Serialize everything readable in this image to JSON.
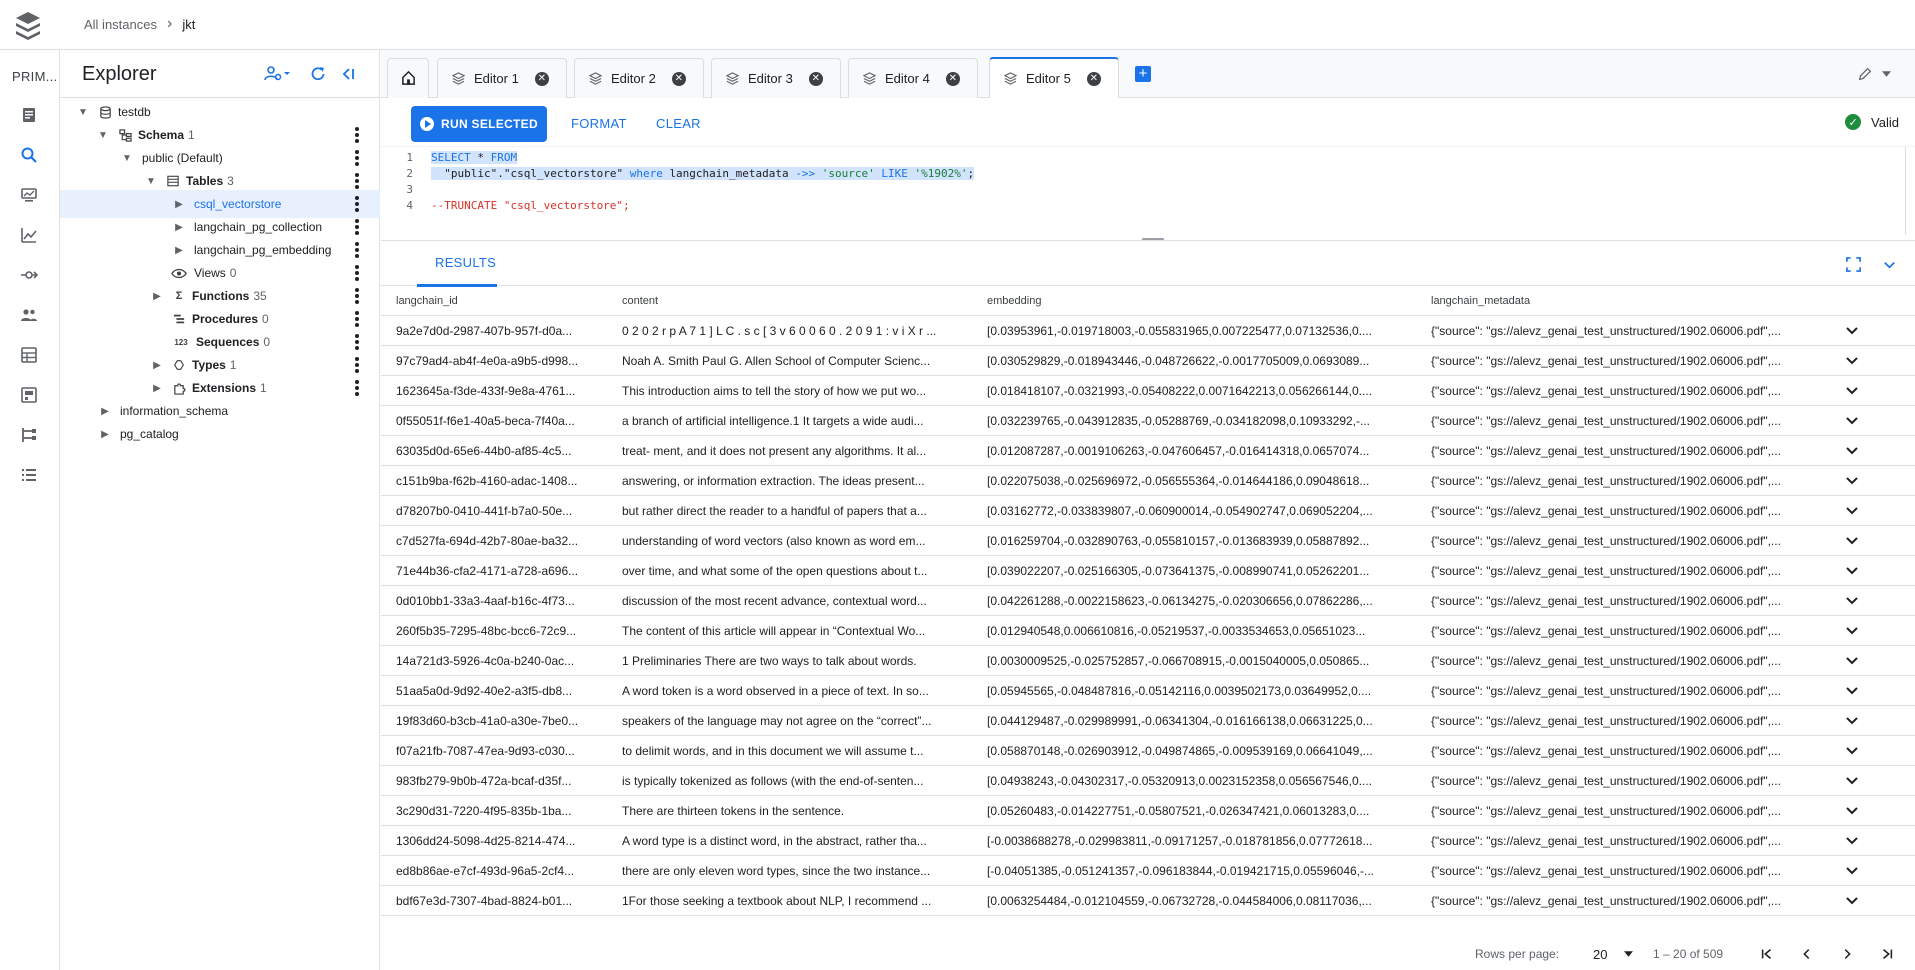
{
  "breadcrumb": {
    "root": "All instances",
    "current": "jkt"
  },
  "rail": {
    "title": "PRIM..."
  },
  "explorer": {
    "title": "Explorer",
    "tree": [
      {
        "name": "tree-node-testdb",
        "label": "testdb",
        "count": ""
      },
      {
        "name": "tree-node-schema",
        "label": "Schema",
        "count": "1"
      },
      {
        "name": "tree-node-public",
        "label": "public (Default)",
        "count": ""
      },
      {
        "name": "tree-node-tables",
        "label": "Tables",
        "count": "3"
      },
      {
        "name": "tree-node-csql-vectorstore",
        "label": "csql_vectorstore",
        "count": ""
      },
      {
        "name": "tree-node-langchain-pg-collection",
        "label": "langchain_pg_collection",
        "count": ""
      },
      {
        "name": "tree-node-langchain-pg-embedding",
        "label": "langchain_pg_embedding",
        "count": ""
      },
      {
        "name": "tree-node-views",
        "label": "Views",
        "count": "0"
      },
      {
        "name": "tree-node-functions",
        "label": "Functions",
        "count": "35"
      },
      {
        "name": "tree-node-procedures",
        "label": "Procedures",
        "count": "0"
      },
      {
        "name": "tree-node-sequences",
        "label": "Sequences",
        "count": "0"
      },
      {
        "name": "tree-node-types",
        "label": "Types",
        "count": "1"
      },
      {
        "name": "tree-node-extensions",
        "label": "Extensions",
        "count": "1"
      },
      {
        "name": "tree-node-information-schema",
        "label": "information_schema",
        "count": ""
      },
      {
        "name": "tree-node-pg-catalog",
        "label": "pg_catalog",
        "count": ""
      }
    ]
  },
  "tabs": [
    {
      "label": "Editor 1"
    },
    {
      "label": "Editor 2"
    },
    {
      "label": "Editor 3"
    },
    {
      "label": "Editor 4"
    },
    {
      "label": "Editor 5"
    }
  ],
  "toolbar": {
    "run_label": "RUN SELECTED",
    "format_label": "FORMAT",
    "clear_label": "CLEAR",
    "status_label": "Valid"
  },
  "editor": {
    "lines": [
      {
        "num": "1"
      },
      {
        "num": "2"
      },
      {
        "num": "3"
      },
      {
        "num": "4"
      }
    ],
    "l1_select": "SELECT",
    "l1_star": " * ",
    "l1_from": "FROM",
    "l2_indent": "  ",
    "l2_schema": "\"public\"",
    "l2_dot": ".",
    "l2_table": "\"csql_vectorstore\"",
    "l2_where": " where ",
    "l2_col": "langchain_metadata",
    "l2_op": " ->> ",
    "l2_key": "'source'",
    "l2_like": " LIKE ",
    "l2_pattern": "'%1902%'",
    "l2_semi": ";",
    "l4_comment": "--TRUNCATE \"csql_vectorstore\";"
  },
  "results": {
    "tab_label": "RESULTS",
    "columns": [
      "langchain_id",
      "content",
      "embedding",
      "langchain_metadata"
    ],
    "rows": [
      [
        "9a2e7d0d-2987-407b-957f-d0a...",
        "0 2 0 2 r p A 7 1 ] L C . s c [ 3 v 6 0 0 6 0 . 2 0 9 1 : v i X r ...",
        "[0.03953961,-0.019718003,-0.055831965,0.007225477,0.07132536,0....",
        "{\"source\": \"gs://alevz_genai_test_unstructured/1902.06006.pdf\",..."
      ],
      [
        "97c79ad4-ab4f-4e0a-a9b5-d998...",
        "Noah A. Smith Paul G. Allen School of Computer Scienc...",
        "[0.030529829,-0.018943446,-0.048726622,-0.0017705009,0.0693089...",
        "{\"source\": \"gs://alevz_genai_test_unstructured/1902.06006.pdf\",..."
      ],
      [
        "1623645a-f3de-433f-9e8a-4761...",
        "This introduction aims to tell the story of how we put wo...",
        "[0.018418107,-0.0321993,-0.05408222,0.0071642213,0.056266144,0....",
        "{\"source\": \"gs://alevz_genai_test_unstructured/1902.06006.pdf\",..."
      ],
      [
        "0f55051f-f6e1-40a5-beca-7f40a...",
        "a branch of artificial intelligence.1 It targets a wide audi...",
        "[0.032239765,-0.043912835,-0.05288769,-0.034182098,0.10933292,-...",
        "{\"source\": \"gs://alevz_genai_test_unstructured/1902.06006.pdf\",..."
      ],
      [
        "63035d0d-65e6-44b0-af85-4c5...",
        "treat- ment, and it does not present any algorithms. It al...",
        "[0.012087287,-0.0019106263,-0.047606457,-0.016414318,0.0657074...",
        "{\"source\": \"gs://alevz_genai_test_unstructured/1902.06006.pdf\",..."
      ],
      [
        "c151b9ba-f62b-4160-adac-1408...",
        "answering, or information extraction. The ideas present...",
        "[0.022075038,-0.025696972,-0.056555364,-0.014644186,0.09048618...",
        "{\"source\": \"gs://alevz_genai_test_unstructured/1902.06006.pdf\",..."
      ],
      [
        "d78207b0-0410-441f-b7a0-50e...",
        "but rather direct the reader to a handful of papers that a...",
        "[0.03162772,-0.033839807,-0.060900014,-0.054902747,0.069052204,...",
        "{\"source\": \"gs://alevz_genai_test_unstructured/1902.06006.pdf\",..."
      ],
      [
        "c7d527fa-694d-42b7-80ae-ba32...",
        "understanding of word vectors (also known as word em...",
        "[0.016259704,-0.032890763,-0.055810157,-0.013683939,0.05887892...",
        "{\"source\": \"gs://alevz_genai_test_unstructured/1902.06006.pdf\",..."
      ],
      [
        "71e44b36-cfa2-4171-a728-a696...",
        "over time, and what some of the open questions about t...",
        "[0.039022207,-0.025166305,-0.073641375,-0.008990741,0.05262201...",
        "{\"source\": \"gs://alevz_genai_test_unstructured/1902.06006.pdf\",..."
      ],
      [
        "0d010bb1-33a3-4aaf-b16c-4f73...",
        "discussion of the most recent advance, contextual word...",
        "[0.042261288,-0.0022158623,-0.06134275,-0.020306656,0.07862286,...",
        "{\"source\": \"gs://alevz_genai_test_unstructured/1902.06006.pdf\",..."
      ],
      [
        "260f5b35-7295-48bc-bcc6-72c9...",
        "The content of this article will appear in “Contextual Wo...",
        "[0.012940548,0.006610816,-0.05219537,-0.0033534653,0.05651023...",
        "{\"source\": \"gs://alevz_genai_test_unstructured/1902.06006.pdf\",..."
      ],
      [
        "14a721d3-5926-4c0a-b240-0ac...",
        "1 Preliminaries There are two ways to talk about words.",
        "[0.0030009525,-0.025752857,-0.066708915,-0.0015040005,0.050865...",
        "{\"source\": \"gs://alevz_genai_test_unstructured/1902.06006.pdf\",..."
      ],
      [
        "51aa5a0d-9d92-40e2-a3f5-db8...",
        "A word token is a word observed in a piece of text. In so...",
        "[0.05945565,-0.048487816,-0.05142116,0.0039502173,0.03649952,0....",
        "{\"source\": \"gs://alevz_genai_test_unstructured/1902.06006.pdf\",..."
      ],
      [
        "19f83d60-b3cb-41a0-a30e-7be0...",
        "speakers of the language may not agree on the “correct”...",
        "[0.044129487,-0.029989991,-0.06341304,-0.016166138,0.06631225,0...",
        "{\"source\": \"gs://alevz_genai_test_unstructured/1902.06006.pdf\",..."
      ],
      [
        "f07a21fb-7087-47ea-9d93-c030...",
        "to delimit words, and in this document we will assume t...",
        "[0.058870148,-0.026903912,-0.049874865,-0.009539169,0.06641049,...",
        "{\"source\": \"gs://alevz_genai_test_unstructured/1902.06006.pdf\",..."
      ],
      [
        "983fb279-9b0b-472a-bcaf-d35f...",
        "is typically tokenized as follows (with the end-of-senten...",
        "[0.04938243,-0.04302317,-0.05320913,0.0023152358,0.056567546,0....",
        "{\"source\": \"gs://alevz_genai_test_unstructured/1902.06006.pdf\",..."
      ],
      [
        "3c290d31-7220-4f95-835b-1ba...",
        "There are thirteen tokens in the sentence.",
        "[0.05260483,-0.014227751,-0.05807521,-0.026347421,0.06013283,0....",
        "{\"source\": \"gs://alevz_genai_test_unstructured/1902.06006.pdf\",..."
      ],
      [
        "1306dd24-5098-4d25-8214-474...",
        "A word type is a distinct word, in the abstract, rather tha...",
        "[-0.0038688278,-0.029983811,-0.09171257,-0.018781856,0.07772618...",
        "{\"source\": \"gs://alevz_genai_test_unstructured/1902.06006.pdf\",..."
      ],
      [
        "ed8b86ae-e7cf-493d-96a5-2cf4...",
        "there are only eleven word types, since the two instance...",
        "[-0.04051385,-0.051241357,-0.096183844,-0.019421715,0.05596046,-...",
        "{\"source\": \"gs://alevz_genai_test_unstructured/1902.06006.pdf\",..."
      ],
      [
        "bdf67e3d-7307-4bad-8824-b01...",
        "1For those seeking a textbook about NLP, I recommend ...",
        "[0.0063254484,-0.012104559,-0.06732728,-0.044584006,0.08117036,...",
        "{\"source\": \"gs://alevz_genai_test_unstructured/1902.06006.pdf\",..."
      ]
    ]
  },
  "pagination": {
    "rows_per_page_label": "Rows per page:",
    "rows_per_page": "20",
    "range": "1 – 20 of 509"
  },
  "colors": {
    "accent": "#1a73e8",
    "valid": "#1e8e3e",
    "selection": "#e8f0fe"
  }
}
